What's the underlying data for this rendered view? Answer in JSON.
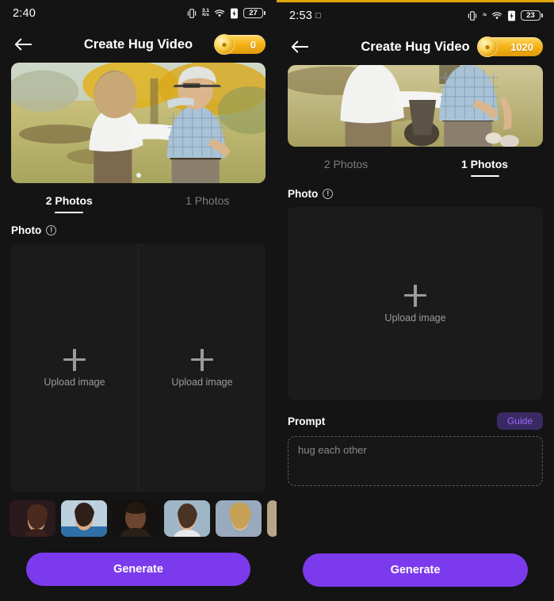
{
  "left": {
    "status": {
      "time": "2:40",
      "network_speed_value": "3.1",
      "network_speed_unit": "K/s",
      "battery_level": "27",
      "icons": [
        "vibrate-icon",
        "network-speed-icon",
        "wifi-icon",
        "sim-icon",
        "battery-icon"
      ]
    },
    "appbar": {
      "back": "back-arrow-icon",
      "title": "Create Hug Video",
      "coin_value": "0",
      "coin_icon": "coin-icon"
    },
    "hero": {
      "alt": "woman hugging older man in a sunny field",
      "dots": 1,
      "active_dot": 0
    },
    "tabs": [
      {
        "label": "2 Photos",
        "active": true
      },
      {
        "label": "1 Photos",
        "active": false
      }
    ],
    "photo_section": {
      "label": "Photo",
      "info_icon": "info-icon"
    },
    "uploads": [
      {
        "label": "Upload image",
        "icon": "plus-icon"
      },
      {
        "label": "Upload image",
        "icon": "plus-icon"
      }
    ],
    "thumbnails": [
      {
        "name": "face-thumb-1"
      },
      {
        "name": "face-thumb-2"
      },
      {
        "name": "face-thumb-3"
      },
      {
        "name": "face-thumb-4"
      },
      {
        "name": "face-thumb-5"
      },
      {
        "name": "face-thumb-6-partial"
      }
    ],
    "generate": "Generate"
  },
  "right": {
    "status": {
      "time": "2:53",
      "network_speed_value": "",
      "network_speed_unit": "/s",
      "battery_level": "23",
      "icons": [
        "vibrate-icon",
        "network-speed-icon",
        "wifi-icon",
        "sim-icon",
        "battery-icon"
      ]
    },
    "appbar": {
      "back": "back-arrow-icon",
      "title": "Create Hug Video",
      "coin_value": "1020",
      "coin_icon": "coin-icon"
    },
    "hero": {
      "alt": "woman reaching to hug older man, cropped",
      "dots": 0,
      "active_dot": 0
    },
    "tabs": [
      {
        "label": "2 Photos",
        "active": false
      },
      {
        "label": "1 Photos",
        "active": true
      }
    ],
    "photo_section": {
      "label": "Photo",
      "info_icon": "info-icon"
    },
    "uploads": [
      {
        "label": "Upload image",
        "icon": "plus-icon"
      }
    ],
    "prompt": {
      "title": "Prompt",
      "guide_label": "Guide",
      "placeholder": "hug each other",
      "value": ""
    },
    "generate": "Generate"
  },
  "colors": {
    "accent_purple": "#7c3aed",
    "guide_text": "#9a6bff",
    "coin_gold": "#f5b318",
    "screen_bg": "#141414",
    "panel_bg": "#1b1b1b",
    "top_border": "#e0a40c"
  }
}
